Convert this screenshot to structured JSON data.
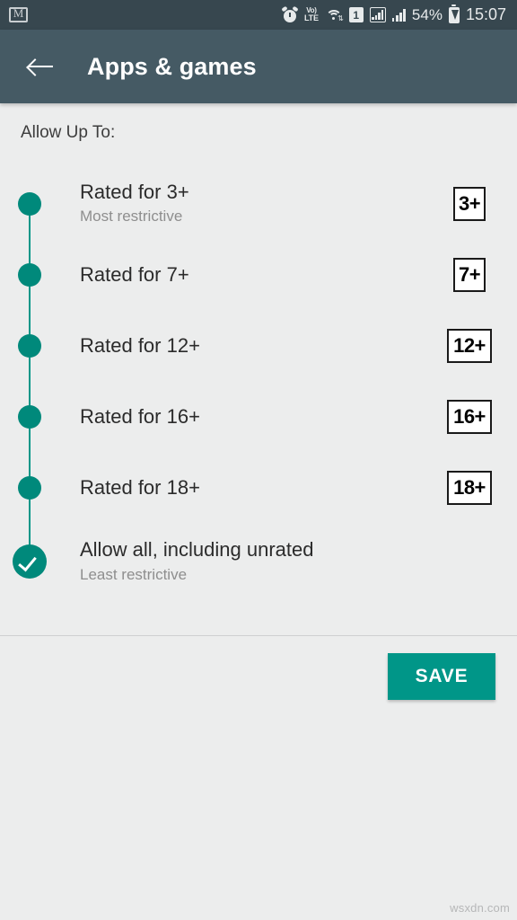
{
  "status_bar": {
    "app_icon": "gmail-icon",
    "icons": [
      "alarm-icon",
      "volte-icon",
      "wifi-icon",
      "sim-icon",
      "signal-boxed-icon",
      "signal-icon"
    ],
    "volte_top": "Vo)",
    "volte_bottom": "LTE",
    "sim_label": "1",
    "battery_percent": "54%",
    "battery_icon": "battery-charging-icon",
    "clock": "15:07",
    "background_color": "#37474f"
  },
  "app_bar": {
    "back_icon": "arrow-back-icon",
    "title": "Apps & games",
    "background_color": "#455a64"
  },
  "content": {
    "section_label": "Allow Up To:",
    "accent_color": "#009688",
    "ratings": [
      {
        "title": "Rated for 3+",
        "subtitle": "Most restrictive",
        "badge": "3+",
        "marker": "dot",
        "selected": false
      },
      {
        "title": "Rated for 7+",
        "subtitle": "",
        "badge": "7+",
        "marker": "dot",
        "selected": false
      },
      {
        "title": "Rated for 12+",
        "subtitle": "",
        "badge": "12+",
        "marker": "dot",
        "selected": false
      },
      {
        "title": "Rated for 16+",
        "subtitle": "",
        "badge": "16+",
        "marker": "dot",
        "selected": false
      },
      {
        "title": "Rated for 18+",
        "subtitle": "",
        "badge": "18+",
        "marker": "dot",
        "selected": false
      },
      {
        "title": "Allow all, including unrated",
        "subtitle": "Least restrictive",
        "badge": "",
        "marker": "check",
        "selected": true
      }
    ]
  },
  "footer": {
    "save_label": "SAVE",
    "save_color": "#009688"
  },
  "watermark": "wsxdn.com"
}
